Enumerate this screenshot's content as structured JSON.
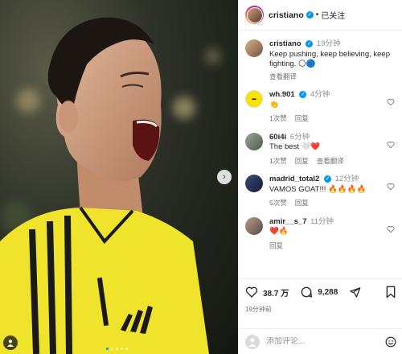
{
  "post": {
    "author": "cristiano",
    "follow_state": "已关注",
    "caption": "Keep pushing, keep believing, keep fighting.",
    "caption_emoji": "🌕🔵",
    "caption_time": "19分钟",
    "caption_translate": "查看翻译",
    "likes": "38.7 万",
    "comments_count": "9,288",
    "posted": "19分钟前"
  },
  "comments": [
    {
      "user": "wh.901",
      "time": "4分钟",
      "text": "👏",
      "likes": "1次赞",
      "reply": "回复",
      "translate": ""
    },
    {
      "user": "60i4i",
      "time": "6分钟",
      "text": "The best 🤍❤️",
      "likes": "1次赞",
      "reply": "回复",
      "translate": "查看翻译"
    },
    {
      "user": "madrid_total2",
      "time": "12分钟",
      "text": "VAMOS GOAT!!! 🔥🔥🔥🔥",
      "likes": "5次赞",
      "reply": "回复",
      "translate": ""
    },
    {
      "user": "amir__s_7",
      "time": "11分钟",
      "text": "❤️🔥",
      "likes": "",
      "reply": "回复",
      "translate": ""
    }
  ],
  "comment_input": {
    "placeholder": "添加评论..."
  },
  "icons": {
    "like": "heart-icon",
    "comment": "comment-icon",
    "share": "paper-plane-icon",
    "save": "bookmark-icon",
    "emoji": "smiley-icon",
    "next": "chevron-right-icon"
  },
  "colors": {
    "verified": "#0095f6",
    "jersey": "#f0e62a",
    "panel_bg": "#ffffff"
  }
}
